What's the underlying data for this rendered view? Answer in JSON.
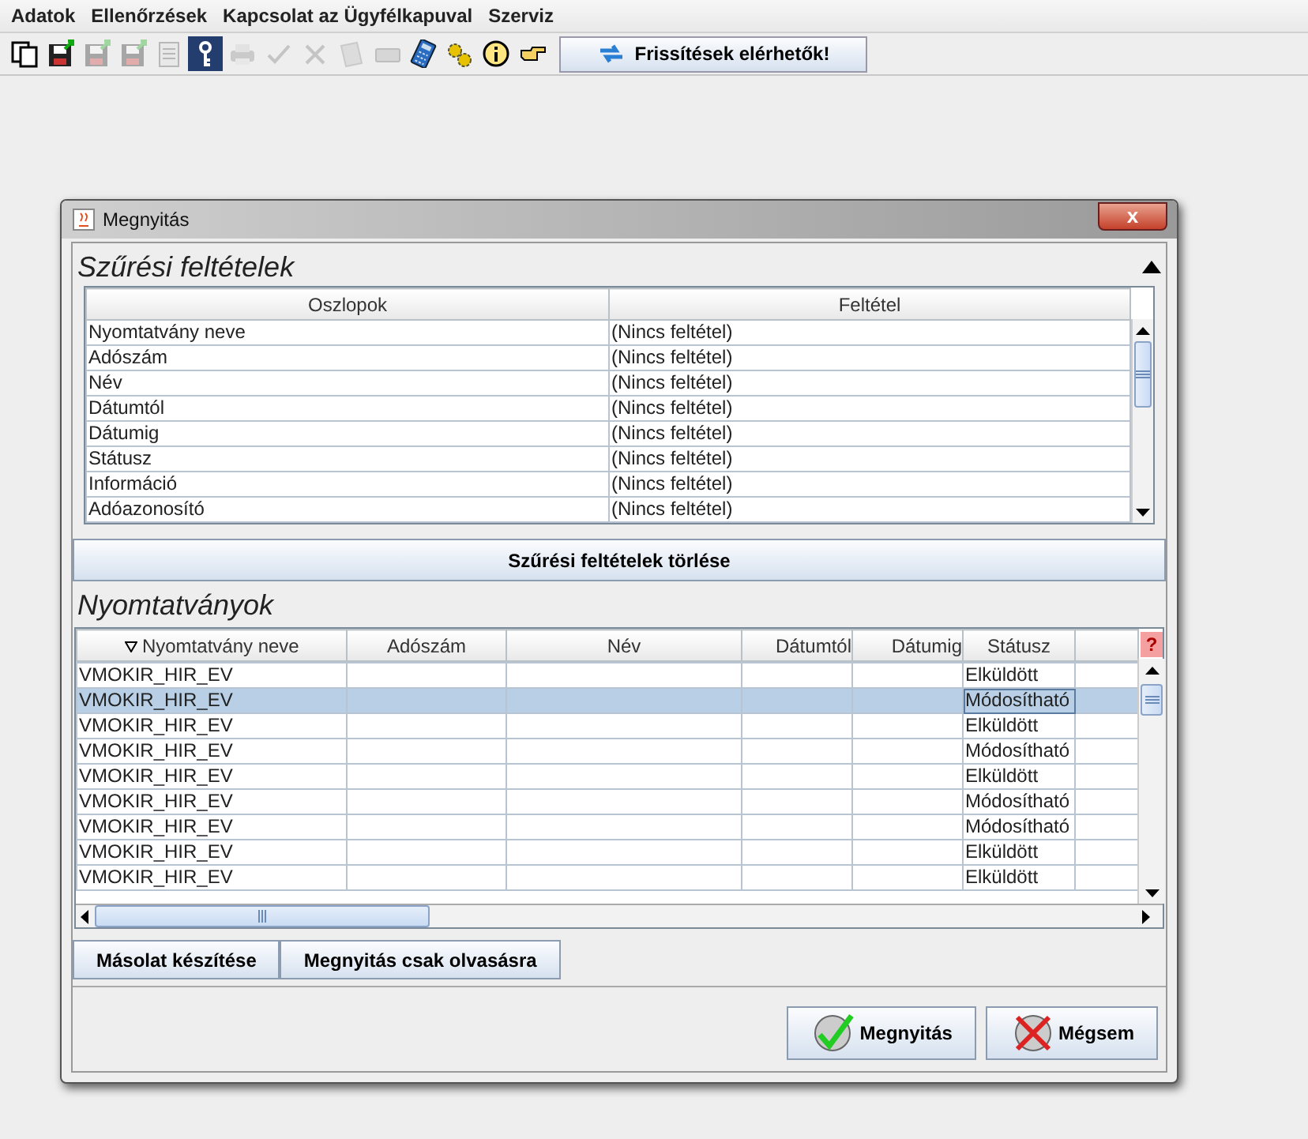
{
  "menu": [
    "Adatok",
    "Ellenőrzések",
    "Kapcsolat az Ügyfélkapuval",
    "Szerviz"
  ],
  "toolbar": [
    {
      "kind": "pages",
      "disabled": false
    },
    {
      "kind": "floppy",
      "disabled": false
    },
    {
      "kind": "floppy",
      "disabled": true
    },
    {
      "kind": "floppy",
      "disabled": true
    },
    {
      "kind": "document",
      "disabled": true
    },
    {
      "kind": "key",
      "disabled": false
    },
    {
      "kind": "printer",
      "disabled": true
    },
    {
      "kind": "check",
      "disabled": true
    },
    {
      "kind": "cross",
      "disabled": true
    },
    {
      "kind": "papers",
      "disabled": true
    },
    {
      "kind": "keyboard",
      "disabled": true
    },
    {
      "kind": "calculator",
      "disabled": false
    },
    {
      "kind": "gears",
      "disabled": false
    },
    {
      "kind": "info",
      "disabled": false
    },
    {
      "kind": "hand",
      "disabled": false
    }
  ],
  "update_button": "Frissítések elérhetők!",
  "dialog": {
    "title": "Megnyitás",
    "close": "x",
    "filter_panel": {
      "title": "Szűrési feltételek",
      "expanded": true,
      "columns": [
        "Oszlopok",
        "Feltétel"
      ],
      "rows": [
        {
          "column": "Nyomtatvány neve",
          "condition": "(Nincs feltétel)"
        },
        {
          "column": "Adószám",
          "condition": "(Nincs feltétel)"
        },
        {
          "column": "Név",
          "condition": "(Nincs feltétel)"
        },
        {
          "column": "Dátumtól",
          "condition": "(Nincs feltétel)"
        },
        {
          "column": "Dátumig",
          "condition": "(Nincs feltétel)"
        },
        {
          "column": "Státusz",
          "condition": "(Nincs feltétel)"
        },
        {
          "column": "Információ",
          "condition": "(Nincs feltétel)"
        },
        {
          "column": "Adóazonosító",
          "condition": "(Nincs feltétel)"
        }
      ],
      "clear_button": "Szűrési feltételek törlése"
    },
    "forms": {
      "title": "Nyomtatványok",
      "help": "?",
      "columns": [
        {
          "label": "Nyomtatvány neve",
          "sorted": true
        },
        {
          "label": "Adószám",
          "sorted": false
        },
        {
          "label": "Név",
          "sorted": false
        },
        {
          "label": "Dátumtól",
          "sorted": false
        },
        {
          "label": "Dátumig",
          "sorted": false
        },
        {
          "label": "Státusz",
          "sorted": false
        }
      ],
      "rows": [
        {
          "name": "VMOKIR_HIR_EV",
          "status": "Elküldött",
          "selected": false
        },
        {
          "name": "VMOKIR_HIR_EV",
          "status": "Módosítható",
          "selected": true
        },
        {
          "name": "VMOKIR_HIR_EV",
          "status": "Elküldött",
          "selected": false
        },
        {
          "name": "VMOKIR_HIR_EV",
          "status": "Módosítható",
          "selected": false
        },
        {
          "name": "VMOKIR_HIR_EV",
          "status": "Elküldött",
          "selected": false
        },
        {
          "name": "VMOKIR_HIR_EV",
          "status": "Módosítható",
          "selected": false
        },
        {
          "name": "VMOKIR_HIR_EV",
          "status": "Módosítható",
          "selected": false
        },
        {
          "name": "VMOKIR_HIR_EV",
          "status": "Elküldött",
          "selected": false
        },
        {
          "name": "VMOKIR_HIR_EV",
          "status": "Elküldött",
          "selected": false
        }
      ]
    },
    "buttons": [
      "Másolat készítése",
      "Megnyitás csak olvasásra"
    ],
    "actions": [
      {
        "label": "Megnyitás",
        "kind": "ok"
      },
      {
        "label": "Mégsem",
        "kind": "cancel"
      }
    ]
  }
}
